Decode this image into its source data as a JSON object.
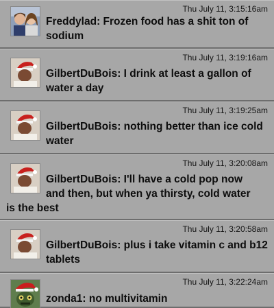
{
  "posts": [
    {
      "timestamp": "Thu July 11, 3:15:16am",
      "author": "Freddylad",
      "text": "Frozen food has a shit ton of sodium",
      "avatar_icon": "couple-photo-avatar"
    },
    {
      "timestamp": "Thu July 11, 3:19:16am",
      "author": "GilbertDuBois",
      "text": "I drink at least a gallon of water a day",
      "avatar_icon": "santa-hat-man-avatar"
    },
    {
      "timestamp": "Thu July 11, 3:19:25am",
      "author": "GilbertDuBois",
      "text": "nothing better than ice cold water",
      "avatar_icon": "santa-hat-man-avatar"
    },
    {
      "timestamp": "Thu July 11, 3:20:08am",
      "author": "GilbertDuBois",
      "text_line1": "GilbertDuBois: I'll have a cold pop now",
      "text_line2": "and then, but when ya thirsty, cold water",
      "text_line3": "is the best",
      "avatar_icon": "santa-hat-man-avatar"
    },
    {
      "timestamp": "Thu July 11, 3:20:58am",
      "author": "GilbertDuBois",
      "text": "plus i take vitamin c and b12 tablets",
      "avatar_icon": "santa-hat-man-avatar"
    },
    {
      "timestamp": "Thu July 11, 3:22:24am",
      "author": "zonda1",
      "text": "no multivitamin",
      "avatar_icon": "santa-hat-creature-avatar"
    }
  ],
  "colors": {
    "background": "#a7a7a7",
    "divider": "#6d6d6d",
    "text": "#0d0d0d"
  }
}
